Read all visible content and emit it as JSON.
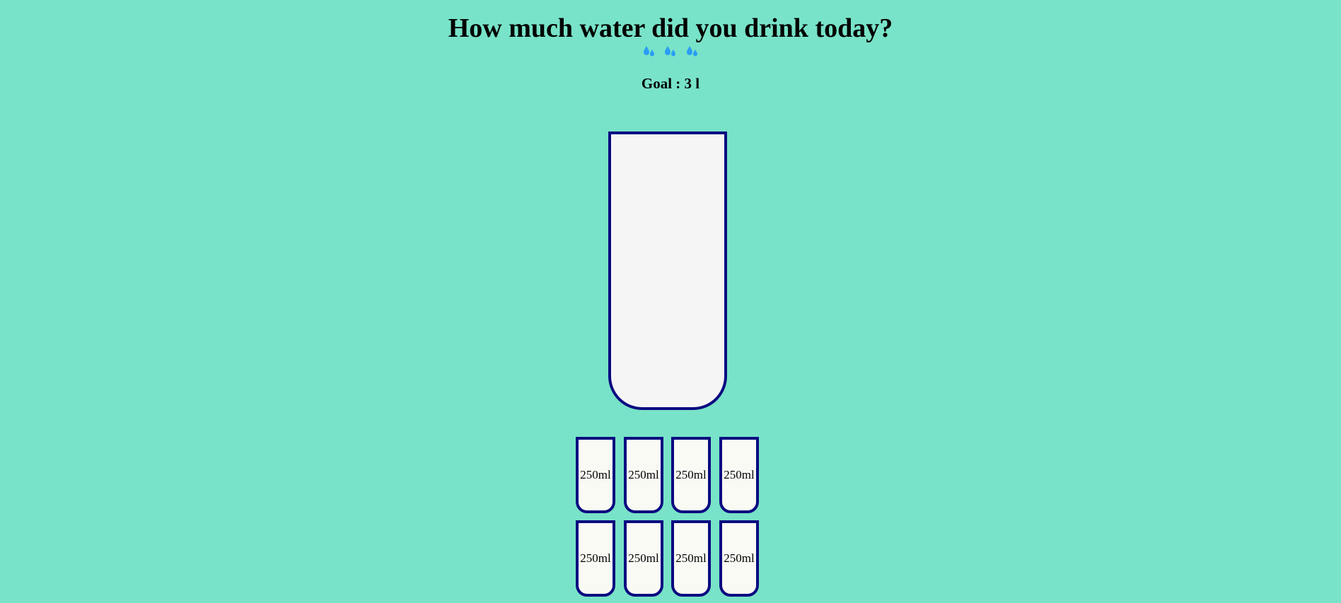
{
  "header": {
    "title": "How much water did you drink today?",
    "drops_icon": "water-drops-icon",
    "goal_text": "Goal : 3 l"
  },
  "big_cup": {
    "fill_fraction": 0
  },
  "small_cups": [
    {
      "label": "250ml"
    },
    {
      "label": "250ml"
    },
    {
      "label": "250ml"
    },
    {
      "label": "250ml"
    },
    {
      "label": "250ml"
    },
    {
      "label": "250ml"
    },
    {
      "label": "250ml"
    },
    {
      "label": "250ml"
    }
  ],
  "colors": {
    "background": "#78e3c8",
    "cup_border": "#0a0a80",
    "cup_fill": "#f5f5f5",
    "drop": "#2a9df4"
  }
}
